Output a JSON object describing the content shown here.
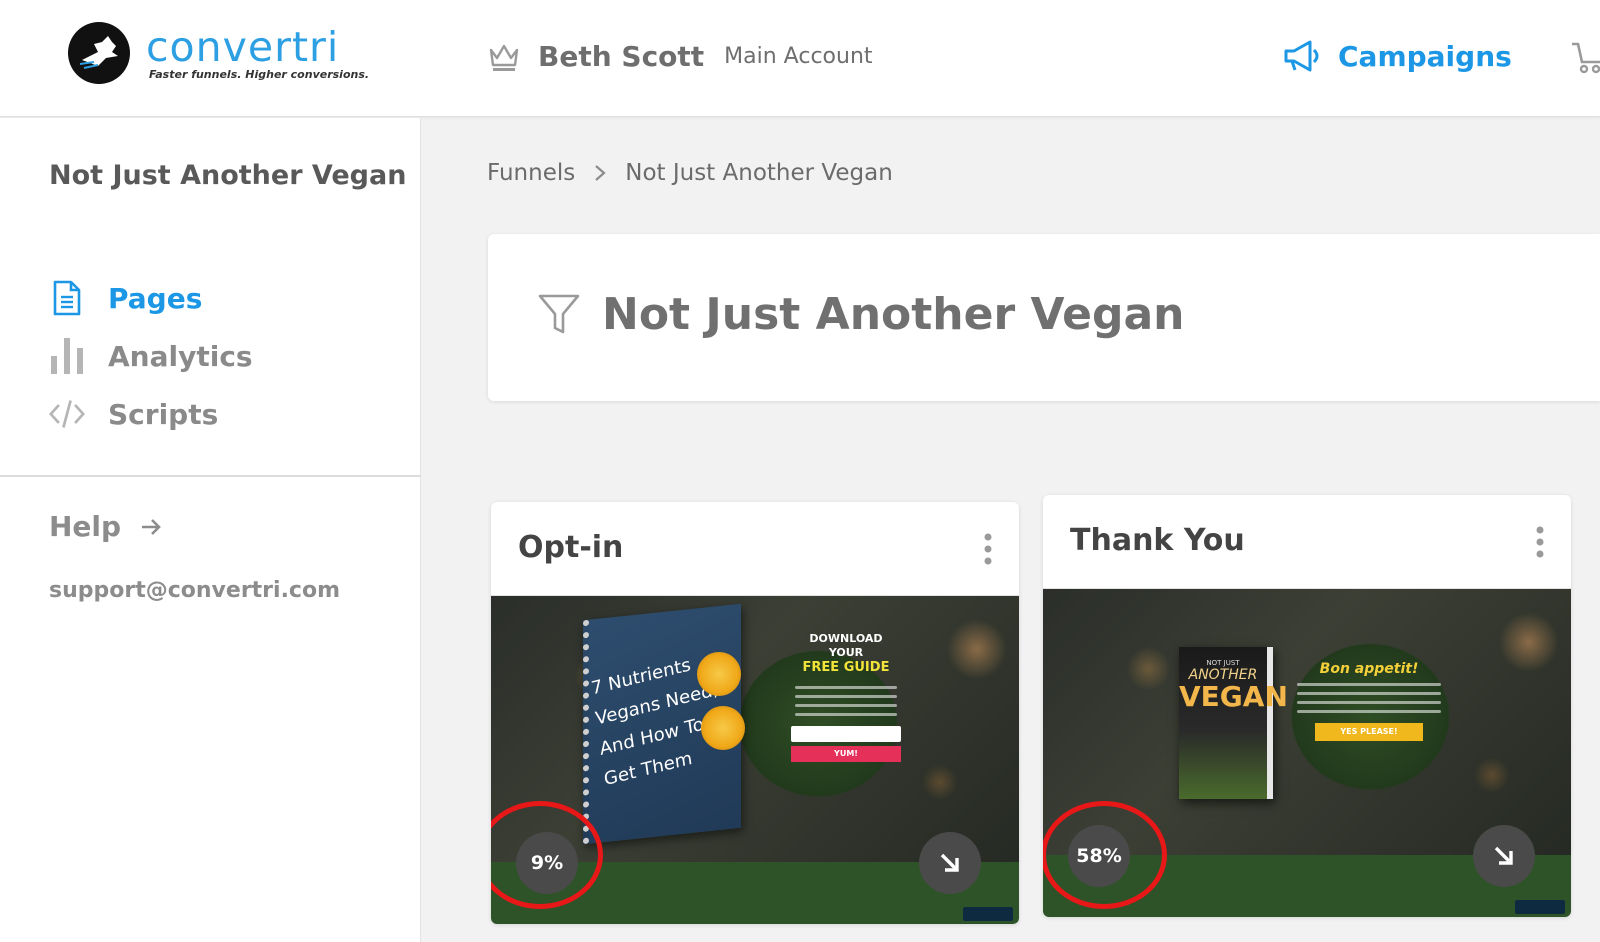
{
  "header": {
    "logo_name": "convertri",
    "logo_tagline": "Faster funnels. Higher conversions.",
    "account_name": "Beth Scott",
    "account_sub": "Main Account",
    "campaigns_label": "Campaigns",
    "accent_color": "#1c97e6"
  },
  "sidebar": {
    "title": "Not Just Another Vegan",
    "items": [
      {
        "label": "Pages",
        "icon": "document-icon",
        "active": true
      },
      {
        "label": "Analytics",
        "icon": "bar-chart-icon",
        "active": false
      },
      {
        "label": "Scripts",
        "icon": "code-icon",
        "active": false
      }
    ],
    "help_label": "Help",
    "support_email": "support@convertri.com"
  },
  "breadcrumb": {
    "root": "Funnels",
    "current": "Not Just Another Vegan"
  },
  "funnel": {
    "title": "Not Just Another Vegan",
    "icon": "funnel-icon"
  },
  "pages": [
    {
      "title": "Opt-in",
      "conversion": "9%",
      "thumbnail": {
        "book_title": "7 Nutrients Vegans Need, And How To Get Them",
        "heading": "DOWNLOAD YOUR",
        "subheading": "FREE GUIDE",
        "button": "YUM!"
      }
    },
    {
      "title": "Thank You",
      "conversion": "58%",
      "thumbnail": {
        "book_small": "NOT JUST",
        "book_line1": "ANOTHER",
        "book_line2": "VEGAN",
        "heading": "Bon appetit!",
        "button": "YES PLEASE!"
      }
    }
  ]
}
